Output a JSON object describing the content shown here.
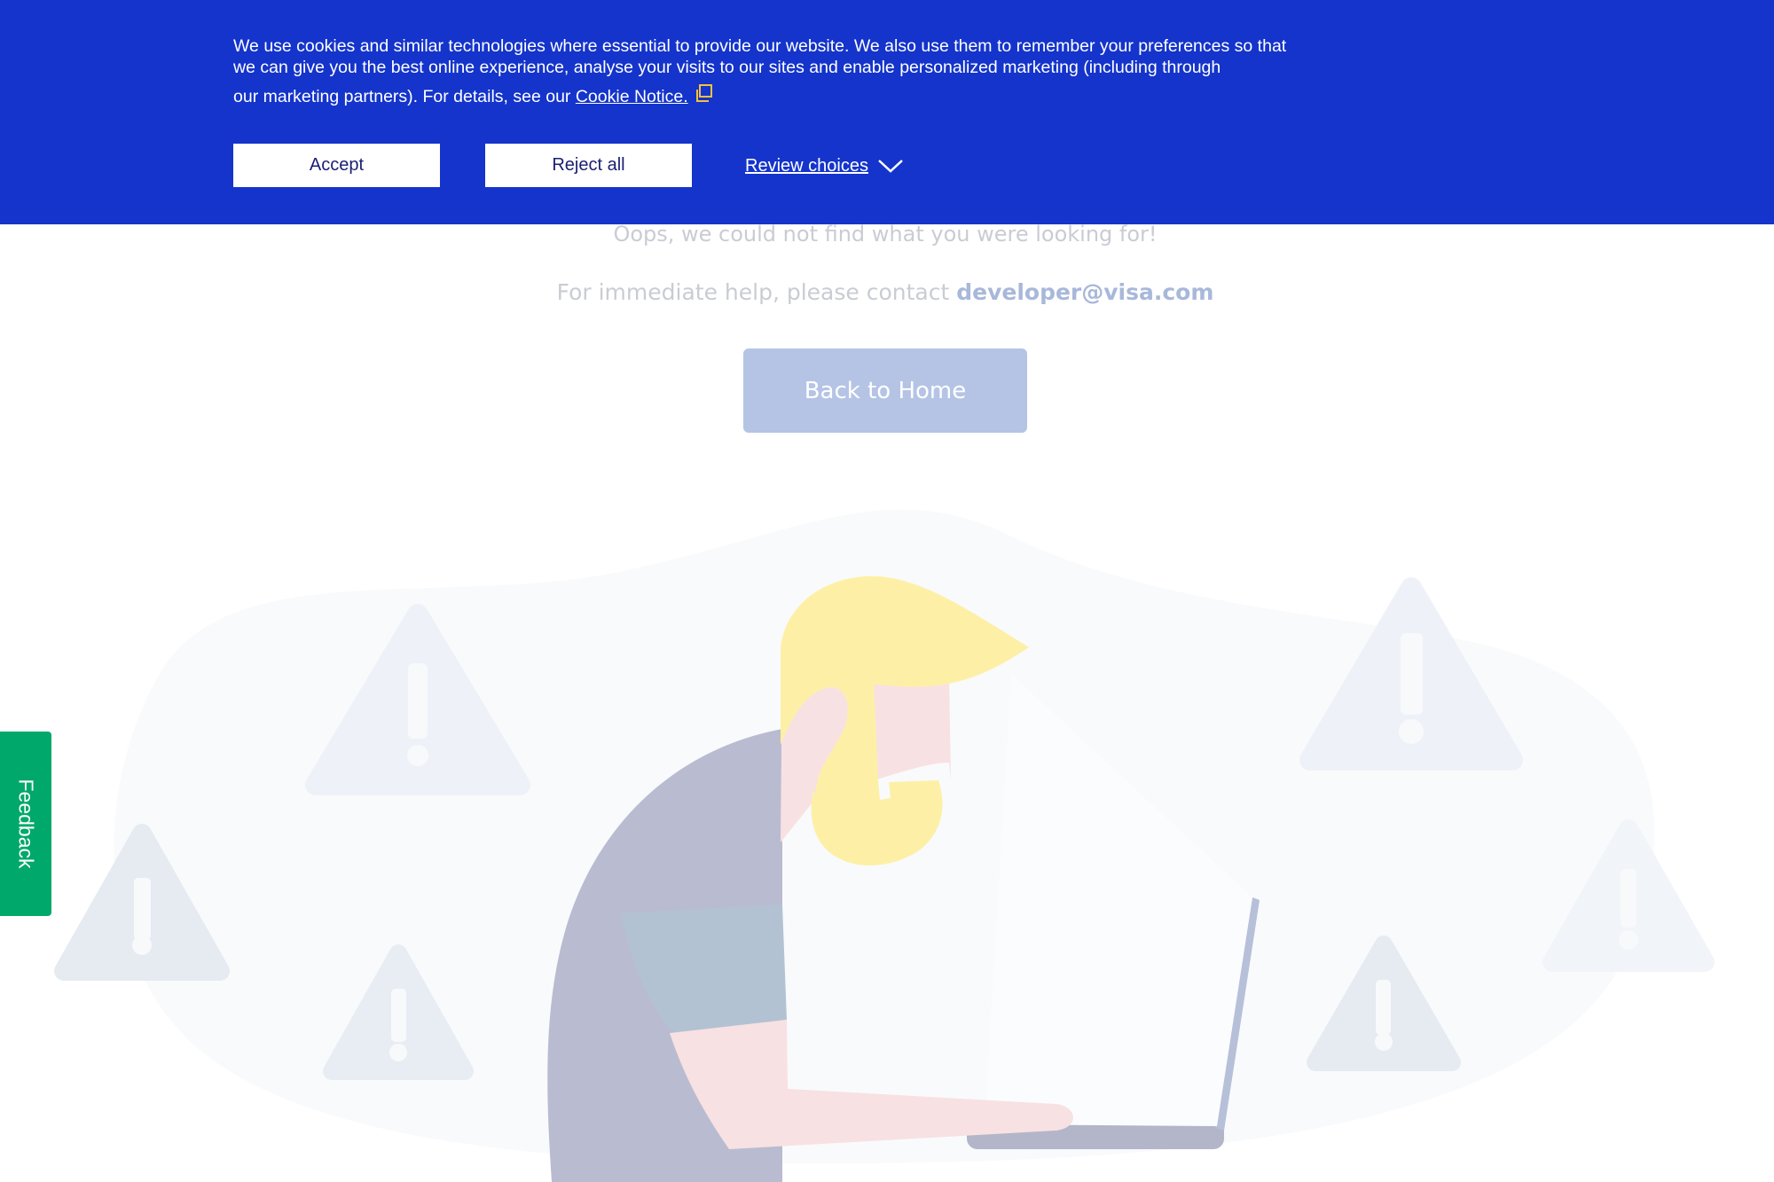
{
  "cookie_banner": {
    "text_part1": "We use cookies and similar technologies where essential to provide our website. We also use them to remember your preferences so that we can give you the best online experience, analyse your visits to our sites and enable personalized marketing (including through",
    "text_part2": "our marketing partners). For details, see our ",
    "cookie_notice_link": "Cookie Notice.",
    "accept_label": "Accept",
    "reject_label": "Reject all",
    "review_label": "Review choices",
    "background_color": "#1434cb"
  },
  "error_page": {
    "message": "Oops, we could not find what you were looking for!",
    "help_prefix": "For immediate help, please contact ",
    "help_email": "developer@visa.com",
    "back_home_label": "Back to Home"
  },
  "feedback": {
    "label": "Feedback",
    "color": "#00a86b"
  },
  "icons": {
    "external_link": "external-link-icon",
    "chevron": "chevron-down-icon",
    "warning": "warning-triangle-icon"
  }
}
